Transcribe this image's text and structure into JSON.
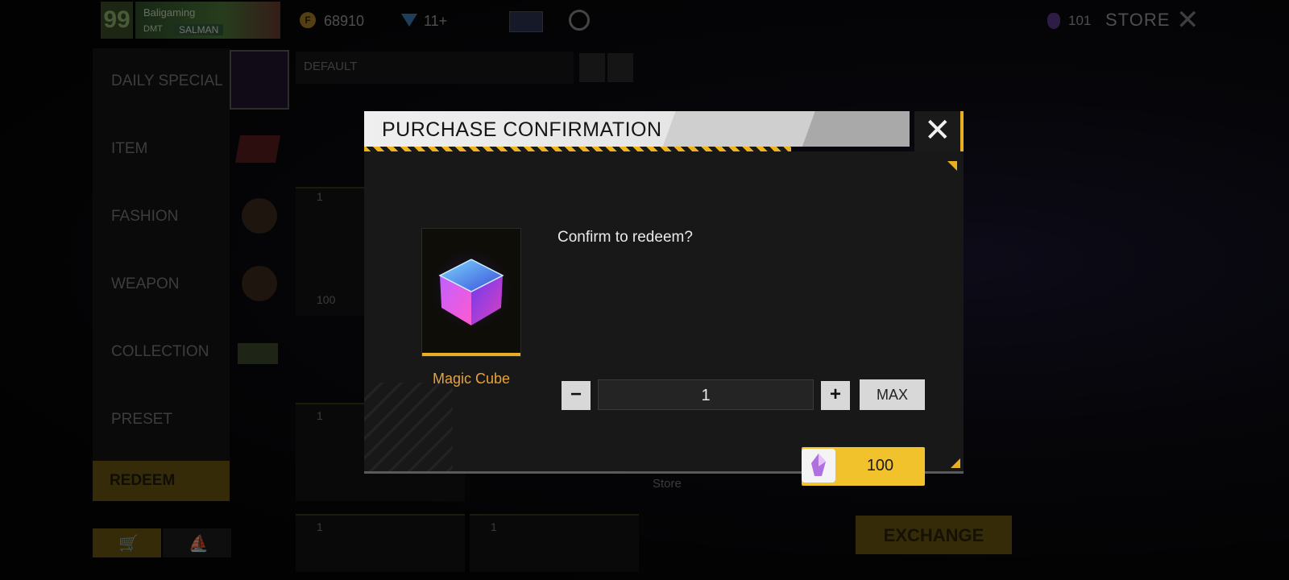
{
  "top_bar": {
    "level": "99",
    "player_name": "Baligaming",
    "guild_tag": "DMT",
    "guild_name": "SALMAN",
    "coins": "68910",
    "diamonds": "11+",
    "gem_count": "101",
    "store_title": "STORE"
  },
  "sidebar": {
    "items": [
      {
        "label": "DAILY SPECIAL"
      },
      {
        "label": "ITEM"
      },
      {
        "label": "FASHION"
      },
      {
        "label": "WEAPON"
      },
      {
        "label": "COLLECTION"
      },
      {
        "label": "PRESET"
      },
      {
        "label": "REDEEM"
      }
    ]
  },
  "content": {
    "filter": "DEFAULT",
    "tile_counts": [
      "1",
      "100",
      "1",
      "1",
      "1"
    ],
    "store_label": "Store",
    "exchange_label": "EXCHANGE"
  },
  "dialog": {
    "title": "PURCHASE CONFIRMATION",
    "prompt": "Confirm to redeem?",
    "item_name": "Magic Cube",
    "quantity": "1",
    "minus_label": "−",
    "plus_label": "+",
    "max_label": "MAX",
    "price": "100",
    "colors": {
      "accent": "#f2c22c",
      "item_name": "#e8a23a",
      "panel": "#181818"
    }
  }
}
